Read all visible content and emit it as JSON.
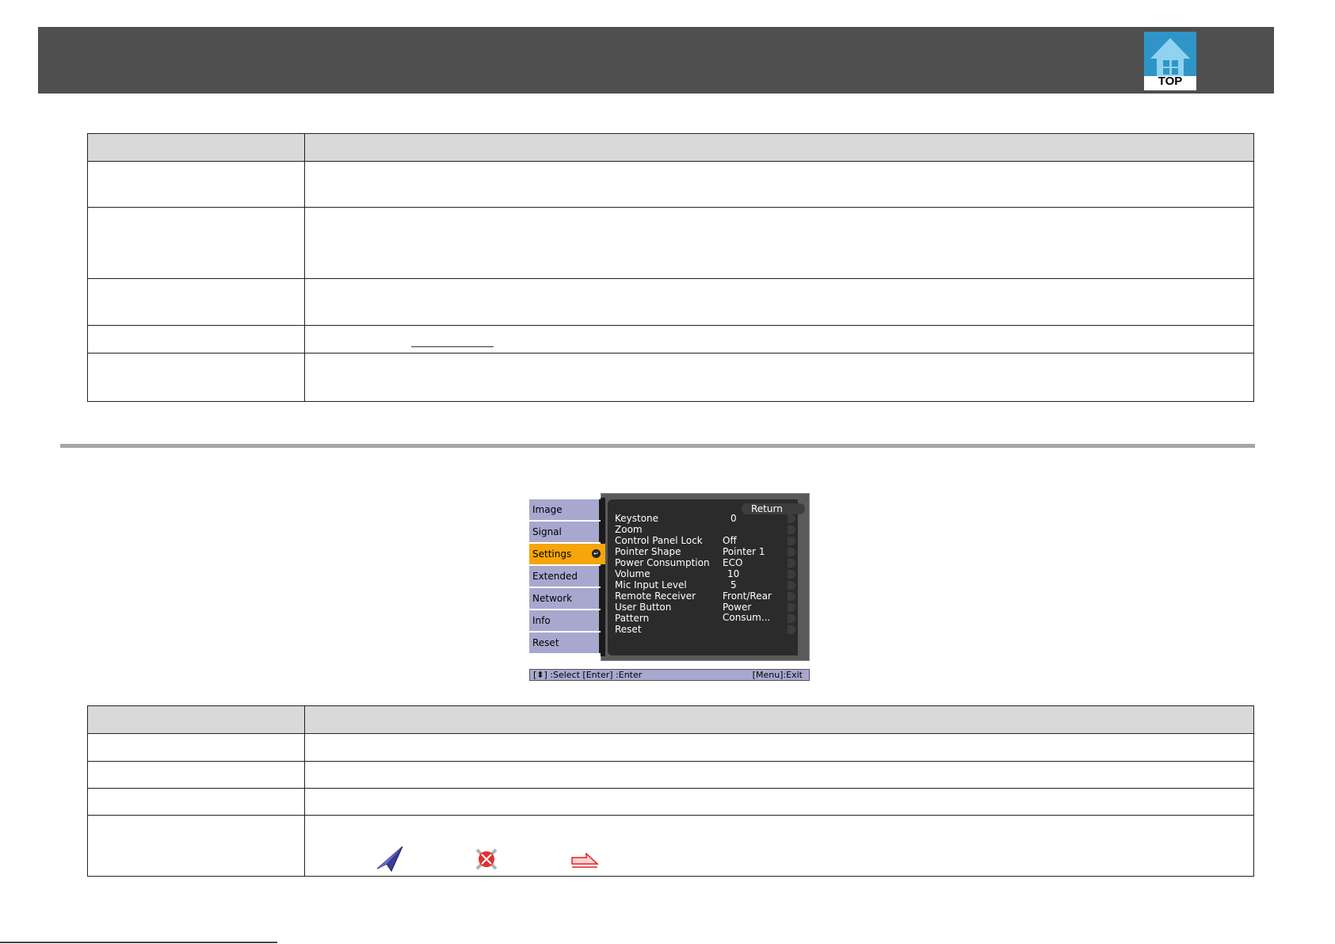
{
  "header": {
    "top_button_label": "TOP"
  },
  "osd_menu": {
    "tabs": [
      {
        "label": "Image",
        "active": false
      },
      {
        "label": "Signal",
        "active": false
      },
      {
        "label": "Settings",
        "active": true
      },
      {
        "label": "Extended",
        "active": false
      },
      {
        "label": "Network",
        "active": false
      },
      {
        "label": "Info",
        "active": false
      },
      {
        "label": "Reset",
        "active": false
      }
    ],
    "return_label": "Return",
    "rows": [
      {
        "label": "Keystone",
        "value": "0"
      },
      {
        "label": "Zoom",
        "value": ""
      },
      {
        "label": "Control Panel Lock",
        "value": "Off"
      },
      {
        "label": "Pointer Shape",
        "value": "Pointer 1"
      },
      {
        "label": "Power Consumption",
        "value": "ECO"
      },
      {
        "label": "Volume",
        "value": "10"
      },
      {
        "label": "Mic Input Level",
        "value": "5"
      },
      {
        "label": "Remote Receiver",
        "value": "Front/Rear"
      },
      {
        "label": "User Button",
        "value": "Power Consum..."
      },
      {
        "label": "Pattern",
        "value": ""
      },
      {
        "label": "Reset",
        "value": ""
      }
    ],
    "help_left": "[⬍] :Select  [Enter] :Enter",
    "help_right": "[Menu]:Exit"
  },
  "colors": {
    "header_bar": "#4f4f4f",
    "tab_active": "#f5a60a",
    "tab_inactive": "#a8a8cf",
    "table_header": "#d9d9d9"
  },
  "pointer_icons": [
    "arrow-pointer-icon",
    "cross-pointer-icon",
    "hand-pointer-icon"
  ]
}
